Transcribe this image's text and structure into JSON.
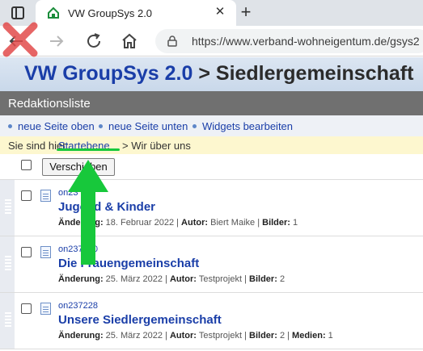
{
  "browser": {
    "tab_title": "VW GroupSys 2.0",
    "url": "https://www.verband-wohneigentum.de/gsys2"
  },
  "page": {
    "app_title": "VW GroupSys 2.0",
    "app_subtitle": "> Siedlergemeinschaft",
    "section_title": "Redaktionsliste",
    "actions": [
      "neue Seite oben",
      "neue Seite unten",
      "Widgets bearbeiten"
    ],
    "breadcrumb": {
      "prefix": "Sie sind hier:",
      "link": "Startebene",
      "rest": "> Wir über uns"
    },
    "move_button": "Verschieben"
  },
  "labels": {
    "changed": "Änderung:",
    "author": "Autor:",
    "images": "Bilder:",
    "media": "Medien:",
    "sep": "|"
  },
  "rows": [
    {
      "id": "on23",
      "title": "Jugend & Kinder",
      "date": "18. Februar 2022",
      "author": "Biert Maike",
      "images": "1",
      "media": ""
    },
    {
      "id": "on237230",
      "title": "Die Frauengemeinschaft",
      "date": "25. März 2022",
      "author": "Testprojekt",
      "images": "2",
      "media": ""
    },
    {
      "id": "on237228",
      "title": "Unsere Siedlergemeinschaft",
      "date": "25. März 2022",
      "author": "Testprojekt",
      "images": "2",
      "media": "1"
    }
  ],
  "colors": {
    "accent": "#1a3ea8",
    "annotation_green": "#17c83b",
    "annotation_red": "#e24b4b"
  },
  "icons": [
    "window-icon",
    "favicon-icon",
    "close-icon",
    "plus-icon",
    "back-arrow-icon",
    "forward-arrow-icon",
    "reload-icon",
    "home-icon",
    "lock-icon",
    "document-icon",
    "drag-handle-icon"
  ]
}
